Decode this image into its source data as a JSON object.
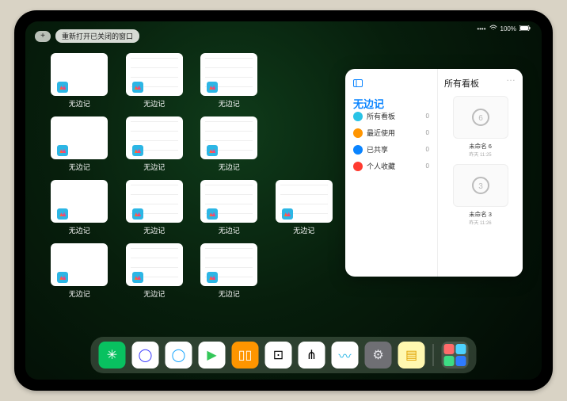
{
  "status": {
    "signal": "••••",
    "wifi": "⌔",
    "battery_pct": "100%"
  },
  "topbar": {
    "plus_label": "+",
    "reopen_label": "重新打开已关闭的窗口"
  },
  "switcher": {
    "app_label": "无边记",
    "thumbs": [
      {
        "style": "blank"
      },
      {
        "style": "grid"
      },
      {
        "style": "grid"
      },
      {
        "style": "blank"
      },
      {
        "style": "grid"
      },
      {
        "style": "grid"
      },
      {
        "style": "blank"
      },
      {
        "style": "grid"
      },
      {
        "style": "grid"
      },
      {
        "style": "grid"
      },
      {
        "style": "blank"
      },
      {
        "style": "grid"
      },
      {
        "style": "grid"
      }
    ]
  },
  "freeform": {
    "title": "无边记",
    "sidebar_icon": "sidebar-icon",
    "right_title": "所有看板",
    "more": "…",
    "items": [
      {
        "icon_color": "#29c3e6",
        "label": "所有看板",
        "count": 0
      },
      {
        "icon_color": "#ff9500",
        "label": "最近使用",
        "count": 0
      },
      {
        "icon_color": "#0a84ff",
        "label": "已共享",
        "count": 0
      },
      {
        "icon_color": "#ff3b30",
        "label": "个人收藏",
        "count": 0
      }
    ],
    "boards": [
      {
        "glyph": "6",
        "name": "未命名 6",
        "time": "昨天 11:25"
      },
      {
        "glyph": "3",
        "name": "未命名 3",
        "time": "昨天 11:26"
      }
    ]
  },
  "dock": {
    "icons": [
      {
        "name": "wechat-icon",
        "bg": "#08c160",
        "glyph": "✳",
        "fg": "#fff"
      },
      {
        "name": "quark-icon",
        "bg": "#ffffff",
        "glyph": "◯",
        "fg": "#3b3bff"
      },
      {
        "name": "qqbrowser-icon",
        "bg": "#ffffff",
        "glyph": "◯",
        "fg": "#15a6ff"
      },
      {
        "name": "play-icon",
        "bg": "#ffffff",
        "glyph": "▶",
        "fg": "#34c759"
      },
      {
        "name": "books-icon",
        "bg": "#ff9500",
        "glyph": "▯▯",
        "fg": "#fff"
      },
      {
        "name": "dice-icon",
        "bg": "#ffffff",
        "glyph": "⊡",
        "fg": "#000"
      },
      {
        "name": "node-icon",
        "bg": "#ffffff",
        "glyph": "⋔",
        "fg": "#000"
      },
      {
        "name": "freeform-icon",
        "bg": "#ffffff",
        "glyph": "〰",
        "fg": "#2cb6e5"
      },
      {
        "name": "settings-icon",
        "bg": "#6f6f74",
        "glyph": "⚙",
        "fg": "#e5e5ea"
      },
      {
        "name": "notes-icon",
        "bg": "#fff8b0",
        "glyph": "▤",
        "fg": "#e0a100"
      }
    ],
    "recent_quad_colors": [
      "#ff6b6b",
      "#4dd2ff",
      "#3ddc84",
      "#2e7bff"
    ]
  }
}
